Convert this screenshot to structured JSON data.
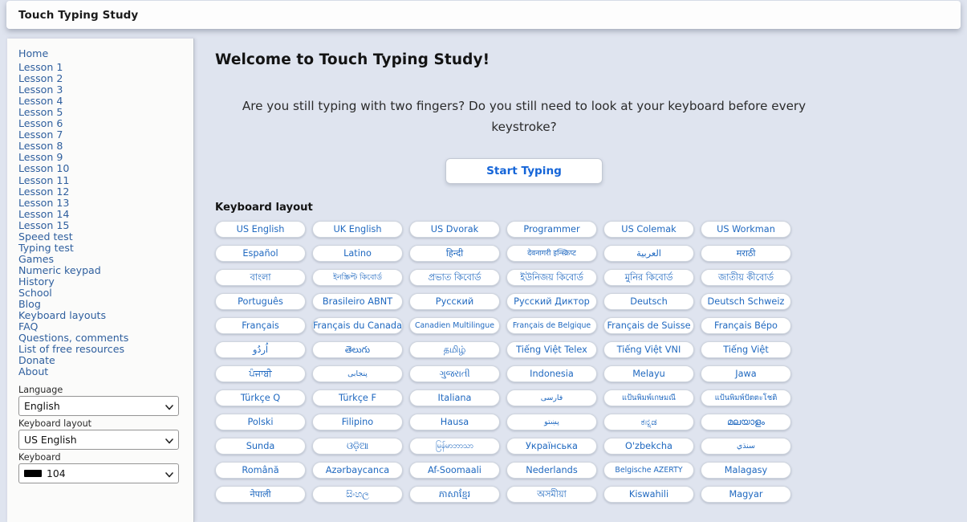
{
  "window": {
    "title": "Touch Typing Study"
  },
  "colors": {
    "page_background": "#dfe4ef",
    "sidebar_background": "#fbfbfa",
    "link_blue": "#2f5f9e",
    "button_text_blue": "#2069c0",
    "accent_blue": "#1565d8"
  },
  "sidebar": {
    "items": [
      {
        "label": "Home"
      },
      {
        "label": "Lesson 1"
      },
      {
        "label": "Lesson 2"
      },
      {
        "label": "Lesson 3"
      },
      {
        "label": "Lesson 4"
      },
      {
        "label": "Lesson 5"
      },
      {
        "label": "Lesson 6"
      },
      {
        "label": "Lesson 7"
      },
      {
        "label": "Lesson 8"
      },
      {
        "label": "Lesson 9"
      },
      {
        "label": "Lesson 10"
      },
      {
        "label": "Lesson 11"
      },
      {
        "label": "Lesson 12"
      },
      {
        "label": "Lesson 13"
      },
      {
        "label": "Lesson 14"
      },
      {
        "label": "Lesson 15"
      },
      {
        "label": "Speed test"
      },
      {
        "label": "Typing test"
      },
      {
        "label": "Games"
      },
      {
        "label": "Numeric keypad"
      },
      {
        "label": "History"
      },
      {
        "label": "School"
      },
      {
        "label": "Blog"
      },
      {
        "label": "Keyboard layouts"
      },
      {
        "label": "FAQ"
      },
      {
        "label": "Questions, comments"
      },
      {
        "label": "List of free resources"
      },
      {
        "label": "Donate"
      },
      {
        "label": "About"
      }
    ],
    "controls": {
      "language": {
        "label": "Language",
        "value": "English"
      },
      "keyboard_layout": {
        "label": "Keyboard layout",
        "value": "US English"
      },
      "keyboard": {
        "label": "Keyboard",
        "value": "104"
      }
    }
  },
  "main": {
    "heading": "Welcome to Touch Typing Study!",
    "intro": "Are you still typing with two fingers? Do you still need to look at your keyboard before every keystroke?",
    "start_button": "Start Typing",
    "keyboard_layout_title": "Keyboard layout",
    "layout_buttons": [
      {
        "label": "US English",
        "size": "md"
      },
      {
        "label": "UK English",
        "size": "md"
      },
      {
        "label": "US Dvorak",
        "size": "md"
      },
      {
        "label": "Programmer",
        "size": "md"
      },
      {
        "label": "US Colemak",
        "size": "md"
      },
      {
        "label": "US Workman",
        "size": "md"
      },
      {
        "label": "Español",
        "size": "md"
      },
      {
        "label": "Latino",
        "size": "md"
      },
      {
        "label": "हिन्दी",
        "size": "md"
      },
      {
        "label": "देवनागरी इन्स्क्रिप्ट",
        "size": "sm"
      },
      {
        "label": "العربية",
        "size": "md"
      },
      {
        "label": "मराठी",
        "size": "md"
      },
      {
        "label": "বাংলা",
        "size": "md"
      },
      {
        "label": "ইনস্ক্রিপ্ট কিবোর্ড",
        "size": "sm"
      },
      {
        "label": "প্রভাত কিবোর্ড",
        "size": "md"
      },
      {
        "label": "ইউনিজয় কিবোর্ড",
        "size": "md"
      },
      {
        "label": "মুনির কিবোর্ড",
        "size": "md"
      },
      {
        "label": "জাতীয় কীবোর্ড",
        "size": "md"
      },
      {
        "label": "Português",
        "size": "md"
      },
      {
        "label": "Brasileiro ABNT",
        "size": "md"
      },
      {
        "label": "Русский",
        "size": "md"
      },
      {
        "label": "Русский Диктор",
        "size": "md"
      },
      {
        "label": "Deutsch",
        "size": "md"
      },
      {
        "label": "Deutsch Schweiz",
        "size": "md"
      },
      {
        "label": "Français",
        "size": "md"
      },
      {
        "label": "Français du Canada",
        "size": "md"
      },
      {
        "label": "Canadien Multilingue",
        "size": "sm"
      },
      {
        "label": "Français de Belgique",
        "size": "sm"
      },
      {
        "label": "Français de Suisse",
        "size": "md"
      },
      {
        "label": "Français Bépo",
        "size": "md"
      },
      {
        "label": "اُردُو",
        "size": "md"
      },
      {
        "label": "తెలుగు",
        "size": "md"
      },
      {
        "label": "தமிழ்",
        "size": "md"
      },
      {
        "label": "Tiếng Việt Telex",
        "size": "md"
      },
      {
        "label": "Tiếng Việt VNI",
        "size": "md"
      },
      {
        "label": "Tiếng Việt",
        "size": "md"
      },
      {
        "label": "ਪੰਜਾਬੀ",
        "size": "md"
      },
      {
        "label": "پنجابی",
        "size": "sm"
      },
      {
        "label": "ગુજરાતી",
        "size": "md"
      },
      {
        "label": "Indonesia",
        "size": "md"
      },
      {
        "label": "Melayu",
        "size": "md"
      },
      {
        "label": "Jawa",
        "size": "md"
      },
      {
        "label": "Türkçe Q",
        "size": "md"
      },
      {
        "label": "Türkçe F",
        "size": "md"
      },
      {
        "label": "Italiana",
        "size": "md"
      },
      {
        "label": "فارسی",
        "size": "sm"
      },
      {
        "label": "แป้นพิมพ์เกษมณี",
        "size": "sm"
      },
      {
        "label": "แป้นพิมพ์ปัตตะโชติ",
        "size": "sm"
      },
      {
        "label": "Polski",
        "size": "md"
      },
      {
        "label": "Filipino",
        "size": "md"
      },
      {
        "label": "Hausa",
        "size": "md"
      },
      {
        "label": "پښتو",
        "size": "sm"
      },
      {
        "label": "ಕನ್ನಡ",
        "size": "md"
      },
      {
        "label": "മലയാളം",
        "size": "md"
      },
      {
        "label": "Sunda",
        "size": "md"
      },
      {
        "label": "ଓଡ଼ିଆ",
        "size": "md"
      },
      {
        "label": "မြန်မာဘာသာ",
        "size": "sm"
      },
      {
        "label": "Українська",
        "size": "md"
      },
      {
        "label": "O'zbekcha",
        "size": "md"
      },
      {
        "label": "سنڌي",
        "size": "sm"
      },
      {
        "label": "Română",
        "size": "md"
      },
      {
        "label": "Azərbaycanca",
        "size": "md"
      },
      {
        "label": "Af-Soomaali",
        "size": "md"
      },
      {
        "label": "Nederlands",
        "size": "md"
      },
      {
        "label": "Belgische AZERTY",
        "size": "sm"
      },
      {
        "label": "Malagasy",
        "size": "md"
      },
      {
        "label": "नेपाली",
        "size": "md"
      },
      {
        "label": "සිංහල",
        "size": "md"
      },
      {
        "label": "ភាសាខ្មែរ",
        "size": "md"
      },
      {
        "label": "অসমীয়া",
        "size": "md"
      },
      {
        "label": "Kiswahili",
        "size": "md"
      },
      {
        "label": "Magyar",
        "size": "md"
      }
    ]
  }
}
